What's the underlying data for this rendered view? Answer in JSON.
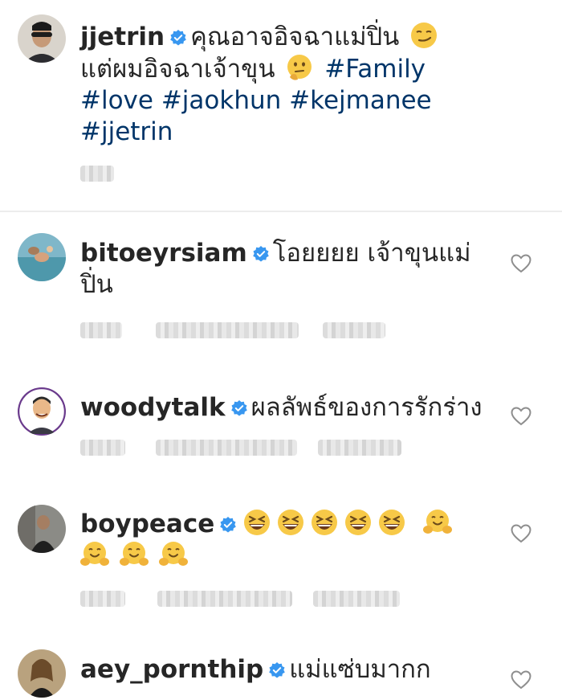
{
  "caption": {
    "username": "jjetrin",
    "line1": "คุณอาจอิจฉาแม่ปิ่น",
    "line2": "แต่ผมอิจฉาเจ้าขุน",
    "hashtags_line2": "#Family",
    "hashtags_line3": "#love #jaokhun #kejmanee",
    "hashtags_line4": "#jjetrin",
    "emoji1": "smirking-face-emoji",
    "emoji2": "thinking-face-emoji"
  },
  "comments": [
    {
      "username": "bitoeyrsiam",
      "line1": "โอยยยย เจ้าขุนแม่",
      "line2": "ปิ่น"
    },
    {
      "username": "woodytalk",
      "line1": "ผลลัพธ์ของการรักร่าง"
    },
    {
      "username": "boypeace",
      "emojis_line1": [
        "grinning-squinting-face-emoji",
        "grinning-squinting-face-emoji",
        "grinning-squinting-face-emoji",
        "grinning-squinting-face-emoji",
        "grinning-squinting-face-emoji",
        "hugging-face-emoji"
      ],
      "emojis_line2": [
        "hugging-face-emoji",
        "hugging-face-emoji",
        "hugging-face-emoji"
      ]
    },
    {
      "username": "aey_pornthip",
      "line1": "แม่แซ่บมากก"
    }
  ],
  "colors": {
    "text": "#262626",
    "hashtag": "#003569",
    "verified_badge": "#3897f0",
    "divider": "#ededed"
  }
}
